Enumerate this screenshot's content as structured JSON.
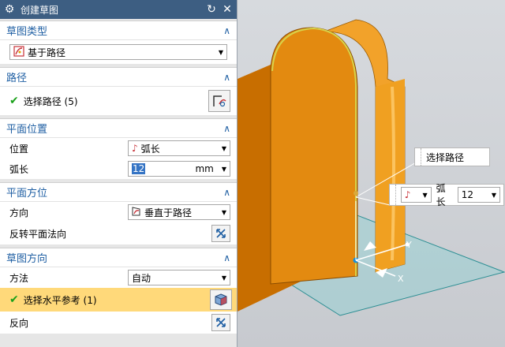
{
  "dialog": {
    "title": "创建草图",
    "icons": [
      "gear-icon",
      "reset-icon",
      "close-icon"
    ]
  },
  "sketch_type": {
    "header": "草图类型",
    "value": "基于路径"
  },
  "path": {
    "header": "路径",
    "select_label": "选择路径 (5)"
  },
  "plane_position": {
    "header": "平面位置",
    "position_label": "位置",
    "position_value": "弧长",
    "arc_label": "弧长",
    "arc_value": "12",
    "arc_unit": "mm"
  },
  "plane_orientation": {
    "header": "平面方位",
    "direction_label": "方向",
    "direction_value": "垂直于路径",
    "reverse_label": "反转平面法向"
  },
  "sketch_orientation": {
    "header": "草图方向",
    "method_label": "方法",
    "method_value": "自动",
    "horizontal_ref_label": "选择水平参考 (1)",
    "reverse_label": "反向"
  },
  "viewport": {
    "callout_label": "选择路径",
    "arc_label": "弧长",
    "arc_value": "12",
    "axis_x": "X",
    "axis_y": "Y"
  },
  "colors": {
    "titlebar": "#3d5e82",
    "section_header": "#1f5fa3",
    "highlight": "#ffd97a",
    "model_orange": "#e38a10",
    "plane_cyan": "#8fd0d2"
  }
}
